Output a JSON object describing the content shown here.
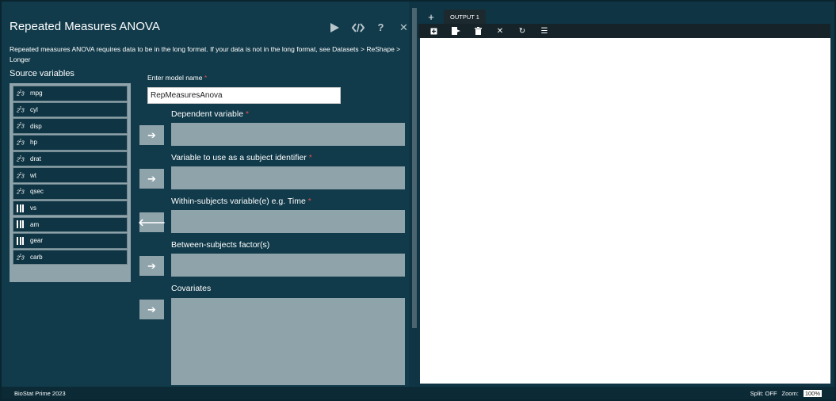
{
  "dialog": {
    "title": "Repeated Measures ANOVA",
    "info_text": "Repeated measures ANOVA requires data to be in the long format. If your data is not in the long format, see Datasets > ReShape > Longer",
    "source_label": "Source variables",
    "model_name_label": "Enter model name",
    "model_name_value": "RepMeasuresAnova",
    "required_mark": "*",
    "variables": [
      {
        "name": "mpg",
        "type": "scale-icon"
      },
      {
        "name": "cyl",
        "type": "scale-icon"
      },
      {
        "name": "disp",
        "type": "scale-icon"
      },
      {
        "name": "hp",
        "type": "scale-icon"
      },
      {
        "name": "drat",
        "type": "scale-icon"
      },
      {
        "name": "wt",
        "type": "scale-icon"
      },
      {
        "name": "qsec",
        "type": "scale-icon"
      },
      {
        "name": "vs",
        "type": "factor-bars-icon"
      },
      {
        "name": "am",
        "type": "factor-bars-icon"
      },
      {
        "name": "gear",
        "type": "factor-bars-icon"
      },
      {
        "name": "carb",
        "type": "scale-icon"
      }
    ],
    "fields": [
      {
        "label": "Dependent variable",
        "required": true
      },
      {
        "label": "Variable to use as a subject identifier",
        "required": true
      },
      {
        "label": "Within-subjects variable(e) e.g. Time",
        "required": true
      },
      {
        "label": "Between-subjects factor(s)",
        "required": false
      },
      {
        "label": "Covariates",
        "required": false
      }
    ]
  },
  "toolbar": {
    "icons": [
      "run-icon",
      "code-icon",
      "help-icon",
      "close-icon"
    ]
  },
  "output": {
    "add_tab": "+",
    "tab_label": "OUTPUT 1",
    "tools": [
      "add-output-icon",
      "export-icon",
      "delete-icon",
      "clear-icon",
      "refresh-icon",
      "list-icon"
    ]
  },
  "status": {
    "app_name": "BioStat Prime 2023",
    "split": "Split: OFF",
    "zoom_label": "Zoom:",
    "zoom_value": "100%"
  },
  "colors": {
    "panel_bg": "#113a4a",
    "target_bg": "#8fa3ab",
    "output_bg": "#ffffff"
  }
}
